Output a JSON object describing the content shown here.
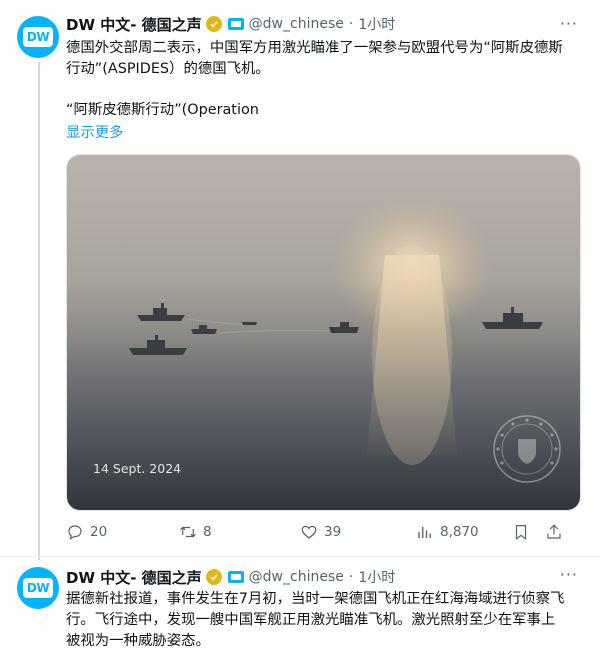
{
  "tweets": [
    {
      "author_name": "DW 中文- 德国之声",
      "avatar_text": "DW",
      "handle": "@dw_chinese",
      "dot": "·",
      "time": "1小时",
      "more": "···",
      "text_line1": "德国外交部周二表示，中国军方用激光瞄准了一架参与欧盟代号为“阿斯皮德斯",
      "text_line2": "行动”(ASPIDES）的德国飞机。",
      "text_line3": "“阿斯皮德斯行动”(Operation",
      "show_more": "显示更多",
      "media": {
        "date_overlay": "14 Sept. 2024",
        "emblem_text": "ASPIDES"
      },
      "stats": {
        "replies": "20",
        "retweets": "8",
        "likes": "39",
        "views": "8,870"
      }
    },
    {
      "author_name": "DW 中文- 德国之声",
      "avatar_text": "DW",
      "handle": "@dw_chinese",
      "dot": "·",
      "time": "1小时",
      "more": "···",
      "text_line1": "据德新社报道，事件发生在7月初，当时一架德国飞机正在红海海域进行侦察飞",
      "text_line2": "行。飞行途中，发现一艘中国军舰正用激光瞄准飞机。激光照射至少在军事上",
      "text_line3": "被视为一种威胁姿态。"
    }
  ],
  "colors": {
    "dw_blue": "#05b2fc",
    "link_blue": "#1d9bf0",
    "verified_gold": "#e2b719",
    "muted_text": "#536471"
  },
  "icons": [
    "reply-icon",
    "retweet-icon",
    "like-icon",
    "views-icon",
    "bookmark-icon",
    "share-icon",
    "verified-badge-icon",
    "affiliate-badge-icon",
    "more-icon"
  ]
}
